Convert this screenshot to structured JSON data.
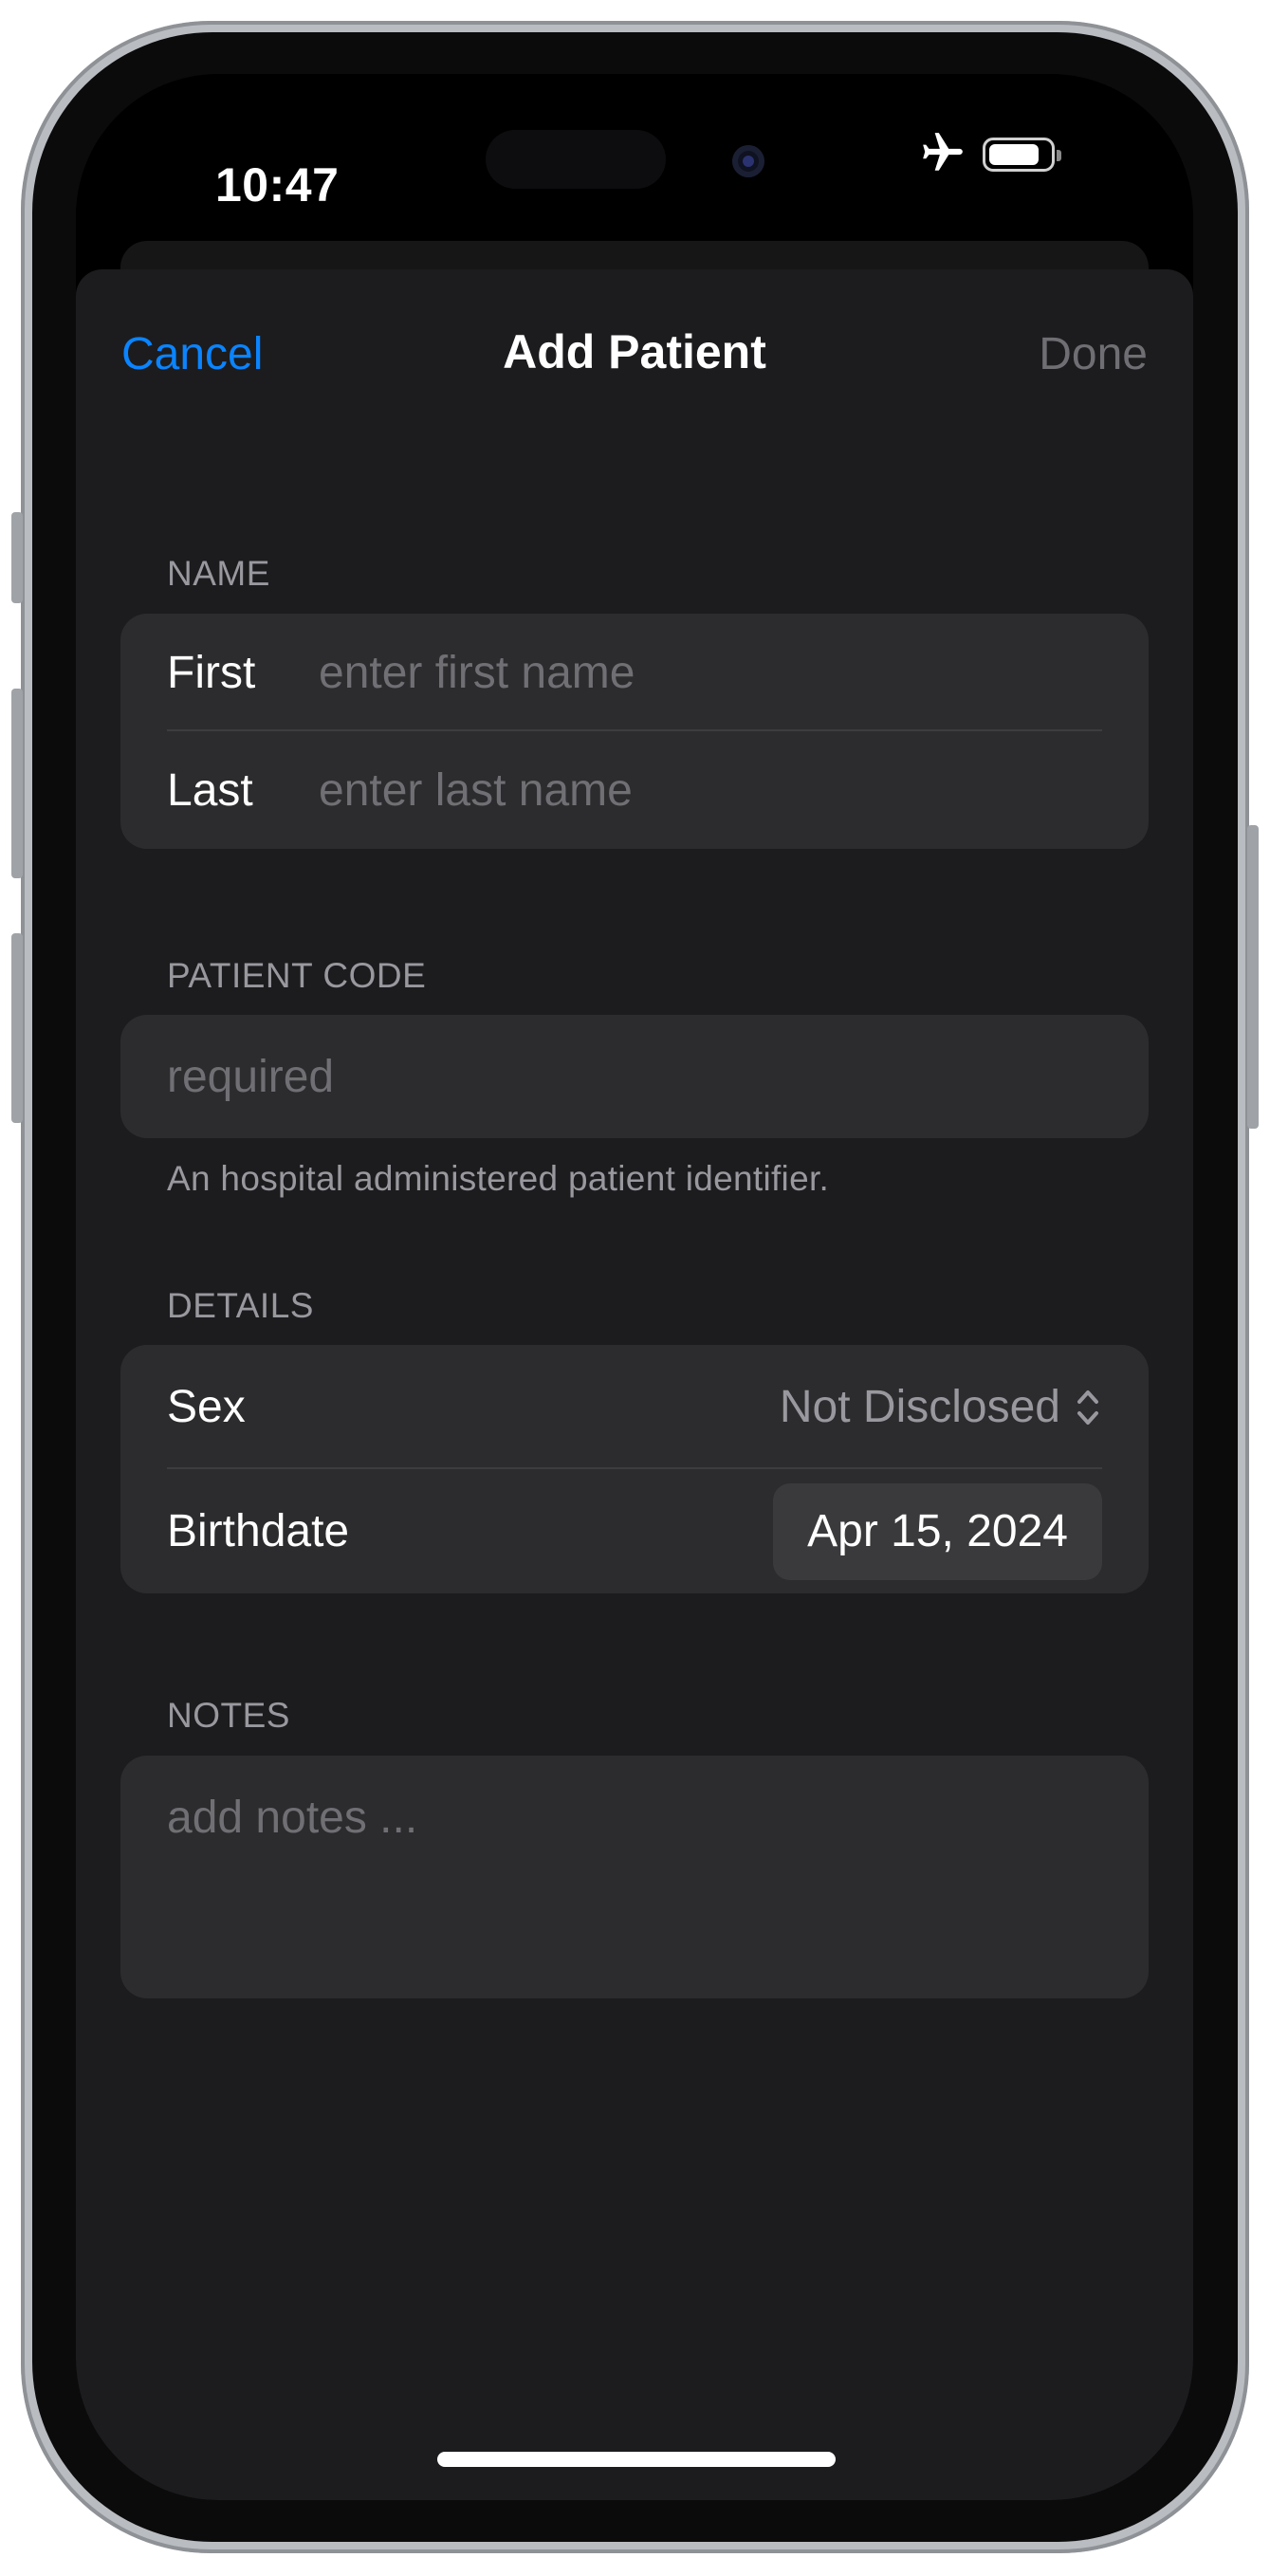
{
  "status_bar": {
    "time": "10:47",
    "airplane_icon": "airplane-icon",
    "battery_icon": "battery-icon"
  },
  "nav": {
    "cancel": "Cancel",
    "title": "Add Patient",
    "done": "Done"
  },
  "name_section": {
    "header": "NAME",
    "first_label": "First",
    "first_placeholder": "enter first name",
    "last_label": "Last",
    "last_placeholder": "enter last name"
  },
  "patient_code_section": {
    "header": "PATIENT CODE",
    "placeholder": "required",
    "footer": "An hospital administered patient identifier."
  },
  "details_section": {
    "header": "DETAILS",
    "sex_label": "Sex",
    "sex_value": "Not Disclosed",
    "birthdate_label": "Birthdate",
    "birthdate_value": "Apr 15, 2024"
  },
  "notes_section": {
    "header": "NOTES",
    "placeholder": "add notes ..."
  },
  "colors": {
    "accent": "#0a84ff",
    "background": "#1c1c1e",
    "cell": "#2c2c2e"
  }
}
